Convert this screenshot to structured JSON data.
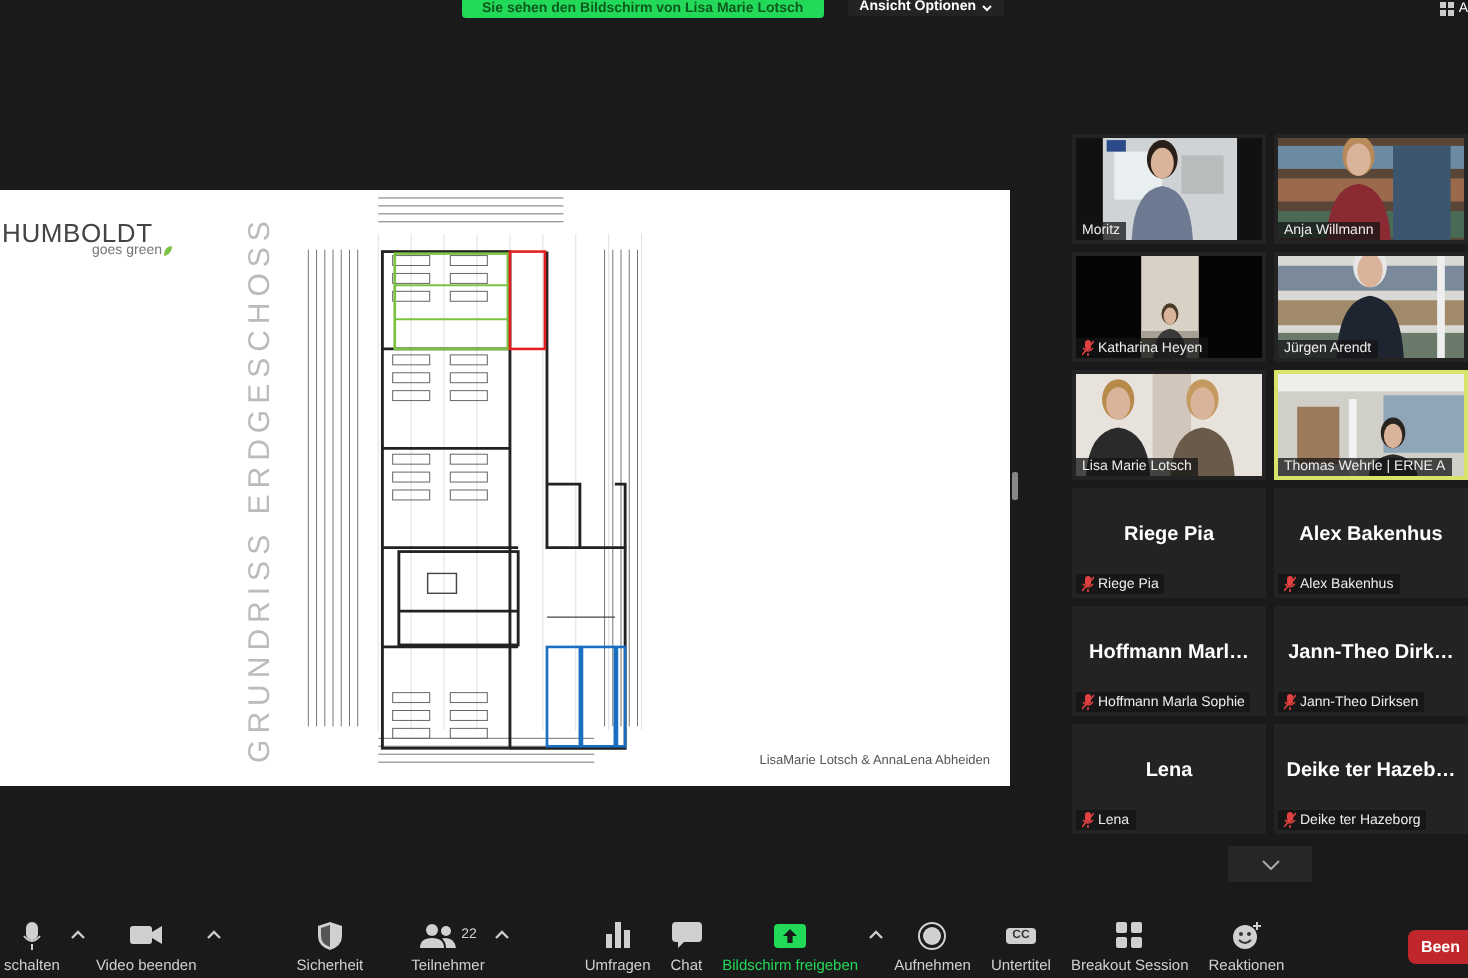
{
  "top_bar": {
    "banner": "Sie sehen den Bildschirm von Lisa Marie Lotsch",
    "view_options": "Ansicht Optionen",
    "corner_label": "A"
  },
  "slide": {
    "logo": "HUMBOLDT",
    "logo_sub": "goes green",
    "title": "GRUNDRISS ERDGESCHOSS",
    "credits": "LisaMarie Lotsch & AnnaLena Abheiden"
  },
  "gallery": [
    {
      "kind": "video",
      "name": "Moritz",
      "muted": false,
      "active": false
    },
    {
      "kind": "video",
      "name": "Anja Willmann",
      "muted": false,
      "active": false
    },
    {
      "kind": "video",
      "name": "Katharina Heyen",
      "muted": true,
      "active": false
    },
    {
      "kind": "video",
      "name": "Jürgen Arendt",
      "muted": false,
      "active": false
    },
    {
      "kind": "video",
      "name": "Lisa Marie Lotsch",
      "muted": false,
      "active": false
    },
    {
      "kind": "video",
      "name": "Thomas Wehrle | ERNE A",
      "muted": false,
      "active": true
    },
    {
      "kind": "name",
      "display": "Riege Pia",
      "name": "Riege Pia",
      "muted": true,
      "active": false
    },
    {
      "kind": "name",
      "display": "Alex Bakenhus",
      "name": "Alex Bakenhus",
      "muted": true,
      "active": false
    },
    {
      "kind": "name",
      "display": "Hoffmann Marl…",
      "name": "Hoffmann Marla Sophie",
      "muted": true,
      "active": false
    },
    {
      "kind": "name",
      "display": "Jann-Theo Dirk…",
      "name": "Jann-Theo Dirksen",
      "muted": true,
      "active": false
    },
    {
      "kind": "name",
      "display": "Lena",
      "name": "Lena",
      "muted": true,
      "active": false
    },
    {
      "kind": "name",
      "display": "Deike ter Hazeb…",
      "name": "Deike ter Hazeborg",
      "muted": true,
      "active": false
    }
  ],
  "toolbar": [
    {
      "kind": "mic",
      "label": "schalten",
      "has_menu": true,
      "active": false
    },
    {
      "kind": "video",
      "label": "Video beenden",
      "has_menu": true,
      "active": false
    },
    {
      "kind": "security",
      "label": "Sicherheit",
      "has_menu": false,
      "active": false
    },
    {
      "kind": "participants",
      "label": "Teilnehmer",
      "count": "22",
      "has_menu": true,
      "active": false
    },
    {
      "kind": "polls",
      "label": "Umfragen",
      "has_menu": false,
      "active": false
    },
    {
      "kind": "chat",
      "label": "Chat",
      "has_menu": false,
      "active": false
    },
    {
      "kind": "share",
      "label": "Bildschirm freigeben",
      "has_menu": true,
      "active": true
    },
    {
      "kind": "record",
      "label": "Aufnehmen",
      "has_menu": false,
      "active": false
    },
    {
      "kind": "captions",
      "label": "Untertitel",
      "icon_text": "CC",
      "has_menu": false,
      "active": false
    },
    {
      "kind": "breakout",
      "label": "Breakout Session",
      "has_menu": false,
      "active": false
    },
    {
      "kind": "reactions",
      "label": "Reaktionen",
      "has_menu": false,
      "active": false
    }
  ],
  "end_button": "Been"
}
